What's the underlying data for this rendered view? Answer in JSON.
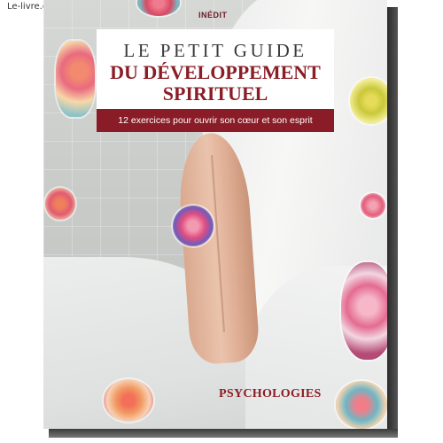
{
  "watermark": "Le-livre.com",
  "cover": {
    "badge": "INÉDIT",
    "title_line1": "LE PETIT GUIDE",
    "title_line2": "DU DÉVELOPPEMENT",
    "title_line3": "SPIRITUEL",
    "subtitle": "12 exercices pour ouvrir son cœur et son esprit",
    "publisher": "PSYCHOLOGIES",
    "colors": {
      "accent": "#8b1d26",
      "title_box": "#ffffff",
      "background": "#c9cbc9"
    }
  }
}
